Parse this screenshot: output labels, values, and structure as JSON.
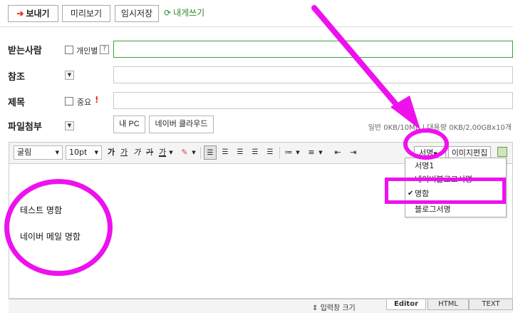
{
  "toolbar": {
    "send_label": "보내기",
    "preview_label": "미리보기",
    "temp_save_label": "임시저장",
    "self_send_label": "내게쓰기"
  },
  "form": {
    "recipient": {
      "label": "받는사람",
      "personal_label": "개인별",
      "help": "?",
      "value": ""
    },
    "cc": {
      "label": "참조",
      "value": ""
    },
    "subject": {
      "label": "제목",
      "important_label": "중요",
      "important_mark": "!",
      "value": ""
    },
    "attach": {
      "label": "파일첨부",
      "my_pc_label": "내 PC",
      "cloud_label": "네이버 클라우드",
      "quota_text": "일반 0KB/10MB  |  대용량 0KB/2,00GBx10개"
    }
  },
  "editor": {
    "font_family": "굴림",
    "font_size": "10pt",
    "format_icons": [
      "가",
      "가",
      "가",
      "가",
      "가"
    ],
    "signature_label": "서명",
    "image_edit_label": "이미지편집",
    "content_lines": [
      "테스트 명함",
      "네이버 메일 명함"
    ],
    "resize_label": "입력창 크기",
    "tabs": [
      "Editor",
      "HTML",
      "TEXT"
    ]
  },
  "signature_menu": {
    "items": [
      {
        "label": "서명1",
        "checked": false
      },
      {
        "label": "네이버블로그서명",
        "checked": false
      },
      {
        "label": "명함",
        "checked": true
      },
      {
        "label": "블로그서명",
        "checked": false
      }
    ]
  },
  "colors": {
    "annotation": "#ee11ee",
    "send_arrow": "#e8341c",
    "self_send": "#2a8a2a",
    "field_active": "#3aa33a"
  }
}
